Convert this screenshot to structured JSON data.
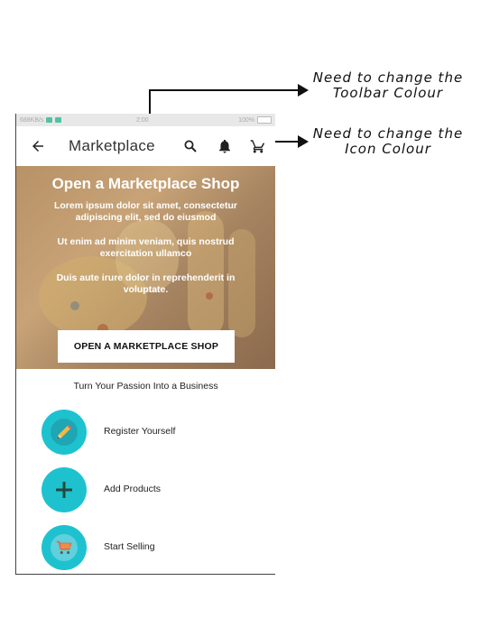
{
  "status_bar": {
    "left_text": "688KB/s",
    "center_text": "2:00",
    "right_text": "100%"
  },
  "toolbar": {
    "title": "Marketplace",
    "icons": [
      "back-arrow-icon",
      "search-icon",
      "bell-icon",
      "cart-icon"
    ]
  },
  "hero": {
    "title": "Open a Marketplace Shop",
    "paragraph_1": "Lorem ipsum dolor sit amet, consectetur adipiscing elit, sed do eiusmod",
    "paragraph_2": "Ut enim ad minim veniam, quis nostrud exercitation ullamco",
    "paragraph_3": "Duis aute irure dolor in reprehenderit in voluptate.",
    "button_label": "OPEN A MARKETPLACE SHOP"
  },
  "tagline": "Turn Your Passion Into a Business",
  "steps": [
    {
      "label": "Register Yourself",
      "icon": "pencil-icon"
    },
    {
      "label": "Add Products",
      "icon": "plus-icon"
    },
    {
      "label": "Start Selling",
      "icon": "shopping-cart-icon"
    }
  ],
  "annotations": {
    "toolbar_note": "Need to change the Toolbar Colour",
    "icon_note": "Need to change the Icon Colour"
  },
  "colors": {
    "accent_circle": "#1ec2cf",
    "accent_inner": "#1fa6b4",
    "hero_tint": "#b79266"
  }
}
